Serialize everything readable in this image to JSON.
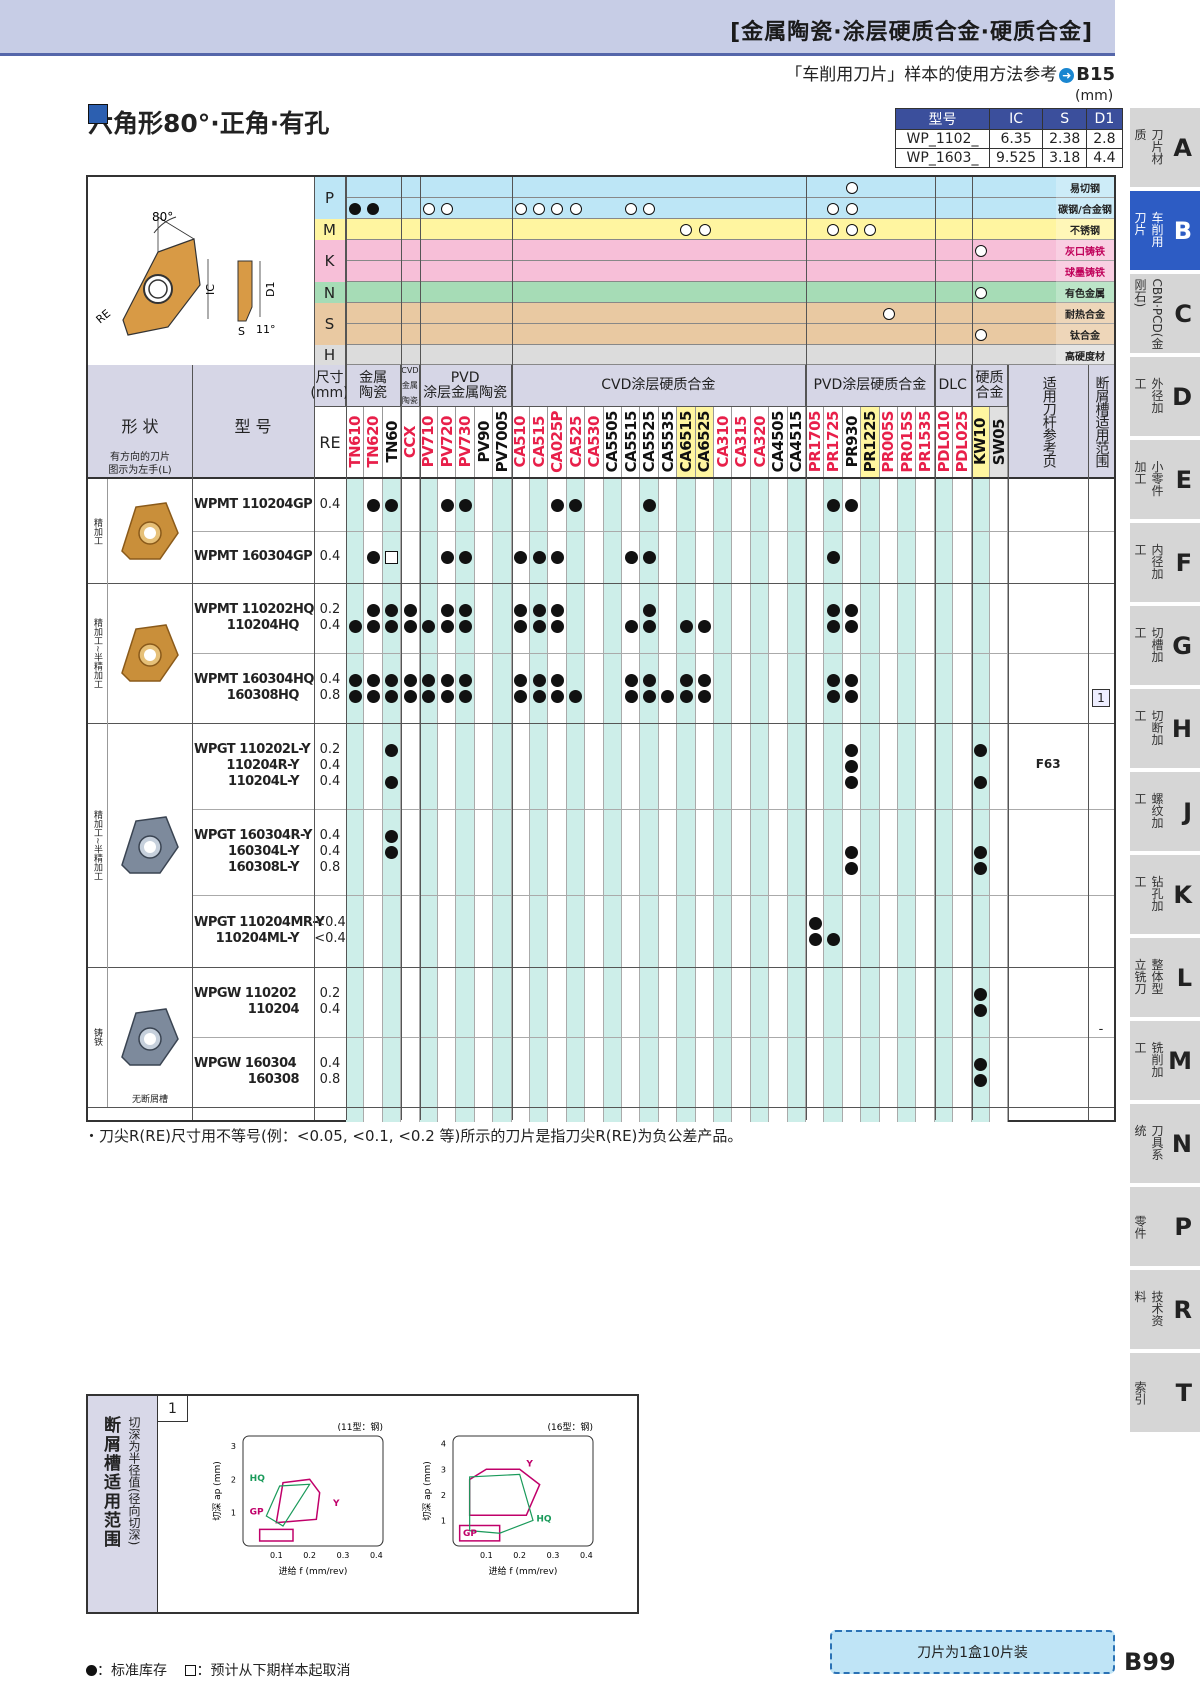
{
  "header": {
    "title": "[金属陶瓷·涂层硬质合金·硬质合金]",
    "ref_text": "「车削用刀片」样本的使用方法参考",
    "ref_page": "B15"
  },
  "section": {
    "title": "六角形80°·正角·有孔"
  },
  "dims": {
    "unit": "(mm)",
    "headers": [
      "型号",
      "IC",
      "S",
      "D1"
    ],
    "rows": [
      [
        "WP_1102_",
        "6.35",
        "2.38",
        "2.8"
      ],
      [
        "WP_1603_",
        "9.525",
        "3.18",
        "4.4"
      ]
    ]
  },
  "diagram": {
    "angle": "80°",
    "re": "RE",
    "ic": "IC",
    "d1": "D1",
    "s": "S",
    "rel": "11°"
  },
  "materials": [
    {
      "code": "P",
      "labels": [
        "易切钢",
        "碳钢/合金钢"
      ],
      "color": "#bde6f6"
    },
    {
      "code": "M",
      "labels": [
        "不锈钢"
      ],
      "color": "#fff5a0"
    },
    {
      "code": "K",
      "labels": [
        "灰口铸铁",
        "球墨铸铁"
      ],
      "color": "#f7bfd8"
    },
    {
      "code": "N",
      "labels": [
        "有色金属"
      ],
      "color": "#a6dcb6"
    },
    {
      "code": "S",
      "labels": [
        "耐热合金",
        "钛合金"
      ],
      "color": "#e9c9a2"
    },
    {
      "code": "H",
      "labels": [
        "高硬度材"
      ],
      "color": "#dcdcdc"
    }
  ],
  "col_groups": [
    {
      "label": "尺寸\n(mm)"
    },
    {
      "label": "金属\n陶瓷"
    },
    {
      "label": "CVD\n金属陶瓷"
    },
    {
      "label": "PVD\n涂层金属陶瓷"
    },
    {
      "label": "CVD涂层硬质合金"
    },
    {
      "label": "PVD涂层硬质合金"
    },
    {
      "label": "DLC"
    },
    {
      "label": "硬质\n合金"
    },
    {
      "label": "适用刀杆参考页"
    },
    {
      "label": "断屑槽适用范围"
    }
  ],
  "shape_header": {
    "title": "形 状",
    "note": "有方向的刀片\n图示为左手(L)"
  },
  "model_header": "型 号",
  "re_header": "RE",
  "grades": [
    {
      "name": "TN610",
      "color": "#e8204a"
    },
    {
      "name": "TN620",
      "color": "#e8204a"
    },
    {
      "name": "TN60",
      "color": "#111"
    },
    {
      "name": "CCX",
      "color": "#e8204a"
    },
    {
      "name": "PV710",
      "color": "#e8204a"
    },
    {
      "name": "PV720",
      "color": "#e8204a"
    },
    {
      "name": "PV730",
      "color": "#e8204a"
    },
    {
      "name": "PV90",
      "color": "#111"
    },
    {
      "name": "PV7005",
      "color": "#111"
    },
    {
      "name": "CA510",
      "color": "#e8204a"
    },
    {
      "name": "CA515",
      "color": "#e8204a"
    },
    {
      "name": "CA025P",
      "color": "#e8204a"
    },
    {
      "name": "CA525",
      "color": "#e8204a"
    },
    {
      "name": "CA530",
      "color": "#e8204a"
    },
    {
      "name": "CA5505",
      "color": "#111"
    },
    {
      "name": "CA5515",
      "color": "#111"
    },
    {
      "name": "CA5525",
      "color": "#111"
    },
    {
      "name": "CA5535",
      "color": "#111"
    },
    {
      "name": "CA6515",
      "color": "#111"
    },
    {
      "name": "CA6525",
      "color": "#111"
    },
    {
      "name": "CA310",
      "color": "#e8204a"
    },
    {
      "name": "CA315",
      "color": "#e8204a"
    },
    {
      "name": "CA320",
      "color": "#e8204a"
    },
    {
      "name": "CA4505",
      "color": "#111"
    },
    {
      "name": "CA4515",
      "color": "#111"
    },
    {
      "name": "PR1705",
      "color": "#e8204a"
    },
    {
      "name": "PR1725",
      "color": "#e8204a"
    },
    {
      "name": "PR930",
      "color": "#111"
    },
    {
      "name": "PR1225",
      "color": "#111"
    },
    {
      "name": "PR005S",
      "color": "#e8204a"
    },
    {
      "name": "PR015S",
      "color": "#e8204a"
    },
    {
      "name": "PR1535",
      "color": "#e8204a"
    },
    {
      "name": "PDL010",
      "color": "#e8204a"
    },
    {
      "name": "PDL025",
      "color": "#e8204a"
    },
    {
      "name": "KW10",
      "color": "#111"
    },
    {
      "name": "SW05",
      "color": "#111"
    }
  ],
  "groups": [
    {
      "label": "精加工",
      "rows": [
        {
          "model": [
            "WPMT 110204GP"
          ],
          "re": [
            "0.4"
          ],
          "dots": [
            [
              1,
              2
            ],
            [
              5,
              6
            ],
            [
              11,
              12
            ],
            [
              16
            ],
            [
              26,
              27
            ]
          ],
          "squares": []
        },
        {
          "model": [
            "WPMT 160304GP"
          ],
          "re": [
            "0.4"
          ],
          "dots": [
            [
              1
            ],
            [
              5,
              6
            ],
            [
              9,
              10,
              11
            ],
            [
              15,
              16
            ],
            [
              26
            ]
          ],
          "squares": [
            2
          ]
        }
      ]
    },
    {
      "label": "精加工~半精加工",
      "rows": [
        {
          "model": [
            "WPMT 110202HQ",
            "110204HQ"
          ],
          "re": [
            "0.2",
            "0.4"
          ]
        },
        {
          "model": [
            "WPMT 160304HQ",
            "160308HQ"
          ],
          "re": [
            "0.4",
            "0.8"
          ]
        }
      ]
    },
    {
      "label": "精加工~半精加工",
      "rows": [
        {
          "model": [
            "WPGT 110202L-Y",
            "110204R-Y",
            "110204L-Y"
          ],
          "re": [
            "0.2",
            "0.4",
            "0.4"
          ]
        },
        {
          "model": [
            "WPGT 160304R-Y",
            "160304L-Y",
            "160308L-Y"
          ],
          "re": [
            "0.4",
            "0.4",
            "0.8"
          ]
        },
        {
          "model": [
            "WPGT 110204MR-Y",
            "110204ML-Y"
          ],
          "re": [
            "<0.4",
            "<0.4"
          ]
        }
      ]
    },
    {
      "label": "铸铁",
      "rows": [
        {
          "model": [
            "WPGW 110202",
            "110204"
          ],
          "re": [
            "0.2",
            "0.4"
          ]
        },
        {
          "model": [
            "WPGW 160304",
            "160308"
          ],
          "re": [
            "0.4",
            "0.8"
          ]
        }
      ]
    }
  ],
  "holder_ref": "F63",
  "chip_ref": "1",
  "chip_ref_cast": "-",
  "no_breaker": "无断屑槽",
  "footnote": "・刀尖R(RE)尺寸用不等号(例：<0.05, <0.1, <0.2 等)所示的刀片是指刀尖R(RE)为负公差产品。",
  "chipbreaker": {
    "title": "断屑槽适用范围",
    "subtitle": "切深为半径值(径向切深)",
    "number": "1",
    "charts": [
      {
        "caption": "(11型：钢)",
        "ylabel": "切深 ap (mm)",
        "xlabel": "进给 f (mm/rev)",
        "xticks": [
          "0.1",
          "0.2",
          "0.3",
          "0.4"
        ],
        "yticks": [
          "1",
          "2",
          "3"
        ],
        "labels": [
          "HQ",
          "GP",
          "Y"
        ]
      },
      {
        "caption": "(16型：钢)",
        "ylabel": "切深 ap (mm)",
        "xlabel": "进给 f (mm/rev)",
        "xticks": [
          "0.1",
          "0.2",
          "0.3",
          "0.4"
        ],
        "yticks": [
          "1",
          "2",
          "3",
          "4"
        ],
        "labels": [
          "Y",
          "HQ",
          "GP"
        ]
      }
    ]
  },
  "legend": {
    "std": "：标准库存",
    "cancel": "：预计从下期样本起取消"
  },
  "box_note": "刀片为1盒10片装",
  "page_no": "B99",
  "tabs": [
    {
      "letter": "A",
      "label": "刀片材质"
    },
    {
      "letter": "B",
      "label": "车削用刀片",
      "active": true
    },
    {
      "letter": "C",
      "label": "CBN·PCD(金刚石)"
    },
    {
      "letter": "D",
      "label": "外径加工"
    },
    {
      "letter": "E",
      "label": "小零件加工"
    },
    {
      "letter": "F",
      "label": "内径加工"
    },
    {
      "letter": "G",
      "label": "切槽加工"
    },
    {
      "letter": "H",
      "label": "切断加工"
    },
    {
      "letter": "J",
      "label": "螺纹加工"
    },
    {
      "letter": "K",
      "label": "钻孔加工"
    },
    {
      "letter": "L",
      "label": "整体型立铣刀"
    },
    {
      "letter": "M",
      "label": "铣削加工"
    },
    {
      "letter": "N",
      "label": "刀具系统"
    },
    {
      "letter": "P",
      "label": "零件"
    },
    {
      "letter": "R",
      "label": "技术资料"
    },
    {
      "letter": "T",
      "label": "索引"
    }
  ]
}
